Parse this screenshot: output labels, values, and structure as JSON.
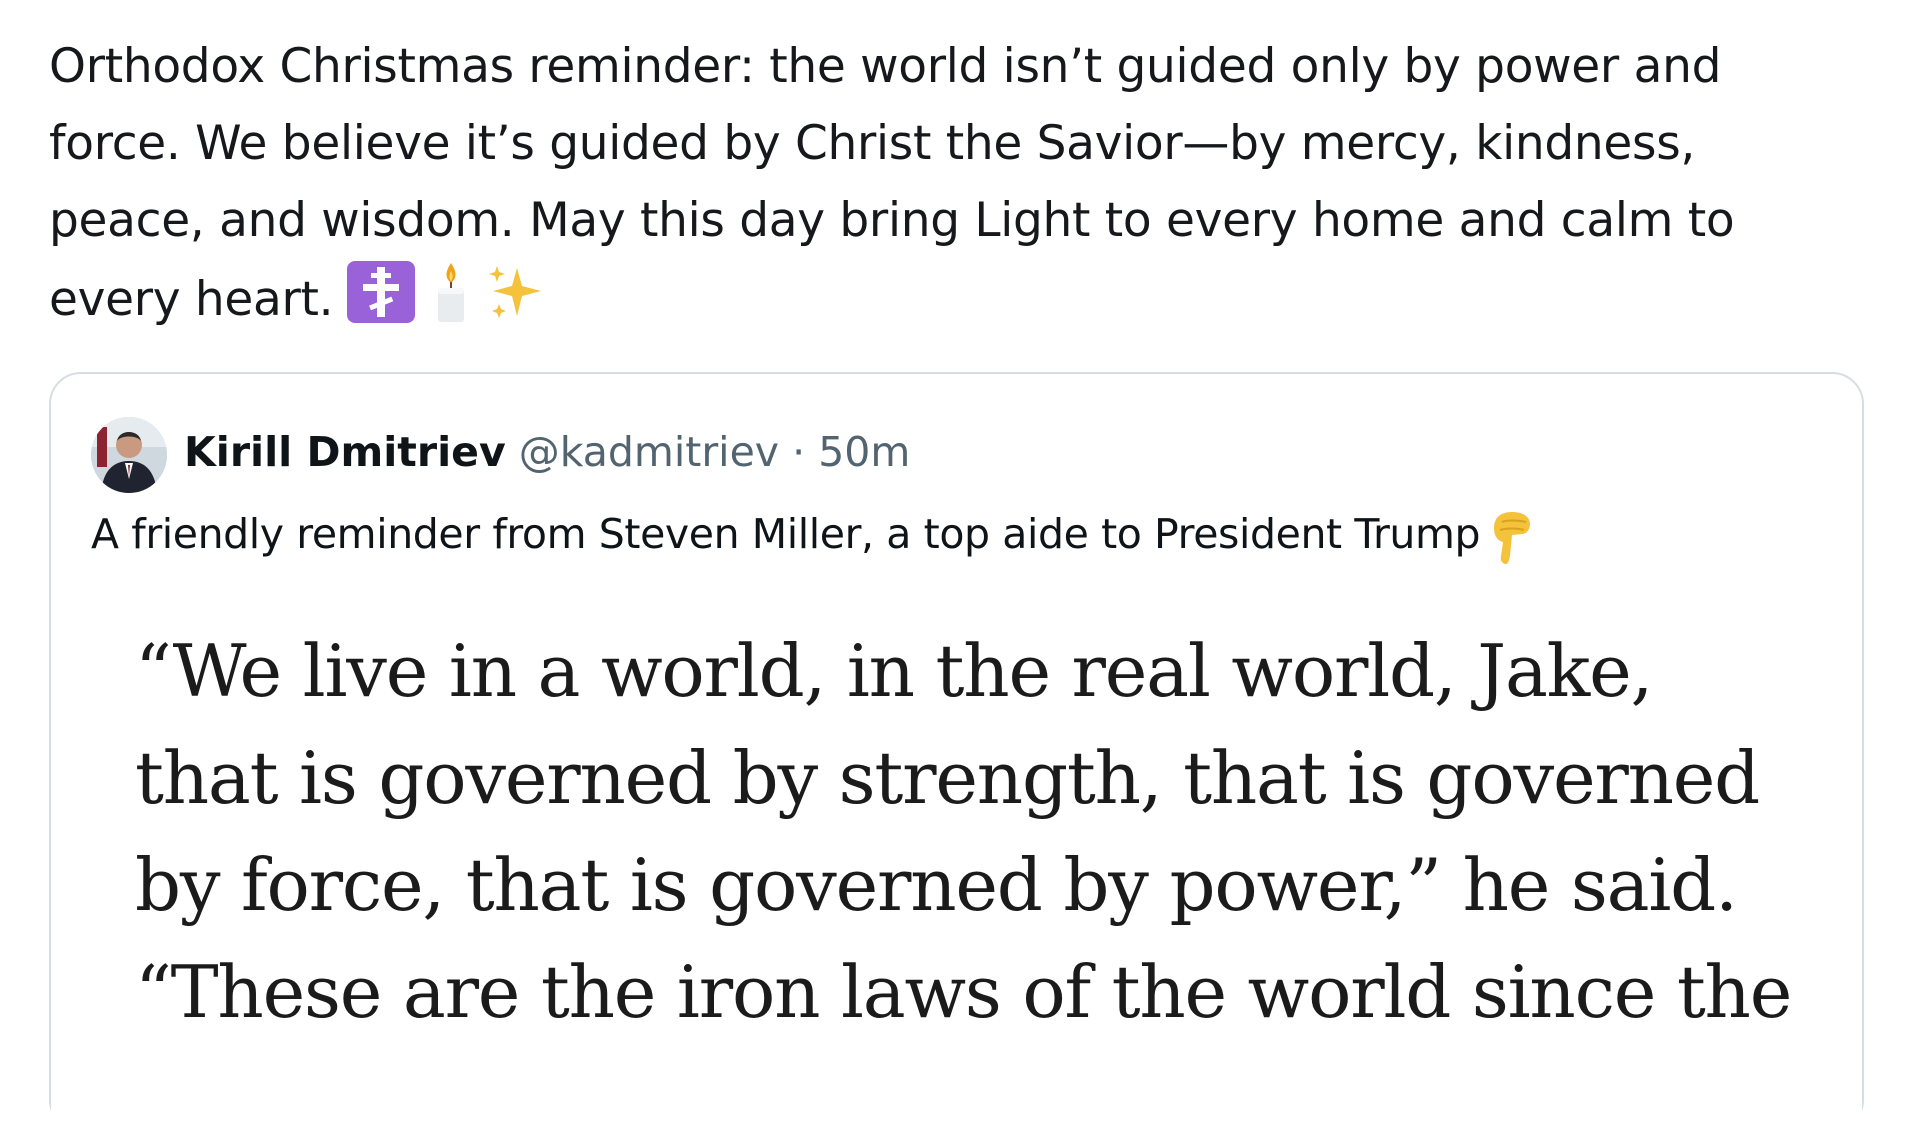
{
  "post": {
    "text": "Orthodox Christmas reminder: the world isn’t guided only by power and\nforce. We believe it’s guided by Christ the Savior—by mercy, kindness,\npeace, and wisdom. May this day bring Light to every home and calm to\nevery heart.",
    "emojis": [
      "orthodox-cross-icon",
      "candle-icon",
      "sparkles-icon"
    ]
  },
  "quoted_post": {
    "author_name": "Kirill Dmitriev",
    "author_handle": "@kadmitriev",
    "separator": "·",
    "time": "50m",
    "text": "A friendly reminder from Steven Miller, a top aide to President Trump",
    "trailing_emoji": "backhand-index-pointing-down-icon",
    "image_text": "“We live in a world, in the real world, Jake,\nthat is governed by strength, that is governed\nby force, that is governed by power,” he said.\n“These are the iron laws of the world since the"
  },
  "colors": {
    "text_primary": "#0f1419",
    "text_secondary": "#536471",
    "card_border": "#d6dde3",
    "cross_bg": "#9a62d8",
    "emoji_yellow": "#f5c23b"
  }
}
